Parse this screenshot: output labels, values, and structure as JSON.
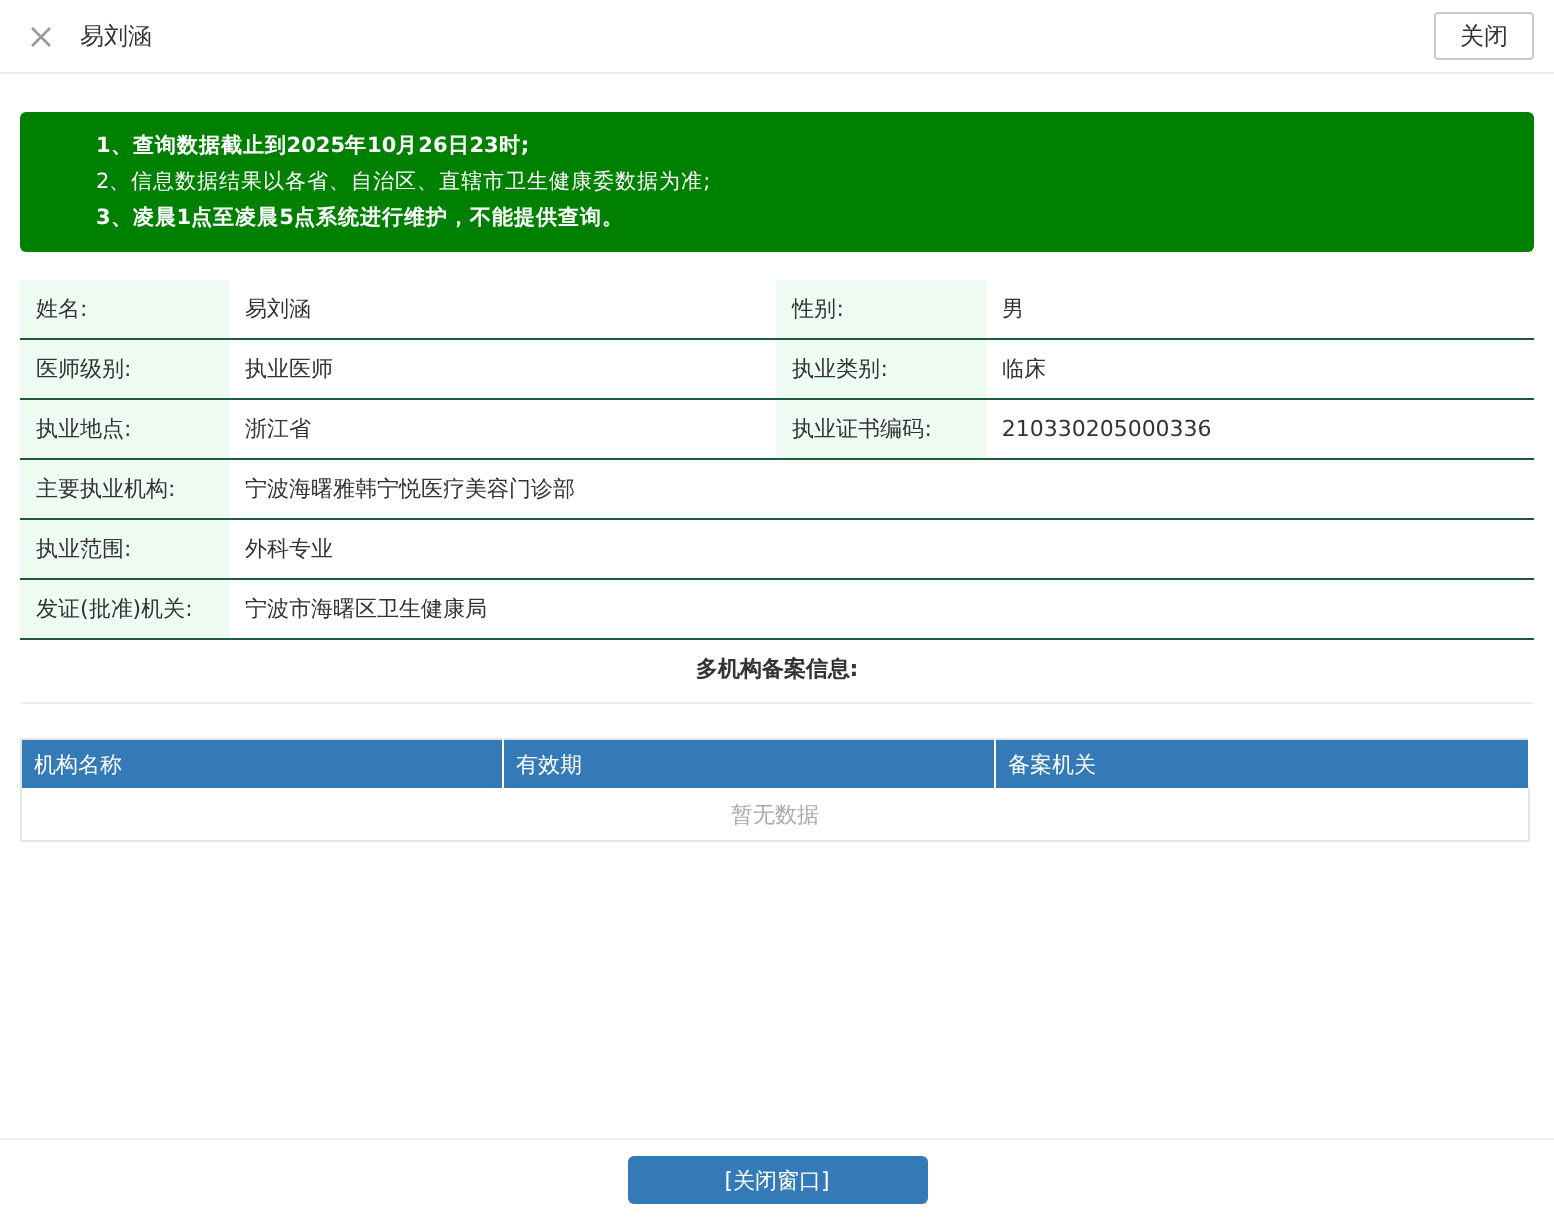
{
  "header": {
    "title": "易刘涵",
    "close_button": "关闭"
  },
  "notice": [
    {
      "text": "1、查询数据截止到2025年10月26日23时;",
      "bold": true
    },
    {
      "text": "2、信息数据结果以各省、自治区、直辖市卫生健康委数据为准;",
      "bold": false
    },
    {
      "text": "3、凌晨1点至凌晨5点系统进行维护，不能提供查询。",
      "bold": true
    }
  ],
  "info_rows": [
    {
      "cells": [
        {
          "label": "姓名:",
          "value": "易刘涵"
        },
        {
          "label": "性别:",
          "value": "男"
        }
      ]
    },
    {
      "cells": [
        {
          "label": "医师级别:",
          "value": "执业医师"
        },
        {
          "label": "执业类别:",
          "value": "临床"
        }
      ]
    },
    {
      "cells": [
        {
          "label": "执业地点:",
          "value": "浙江省"
        },
        {
          "label": "执业证书编码:",
          "value": "210330205000336"
        }
      ]
    },
    {
      "cells": [
        {
          "label": "主要执业机构:",
          "value": "宁波海曙雅韩宁悦医疗美容门诊部"
        }
      ]
    },
    {
      "cells": [
        {
          "label": "执业范围:",
          "value": "外科专业"
        }
      ]
    },
    {
      "cells": [
        {
          "label": "发证(批准)机关:",
          "value": "宁波市海曙区卫生健康局"
        }
      ]
    }
  ],
  "section_title": "多机构备案信息:",
  "table": {
    "columns": [
      "机构名称",
      "有效期",
      "备案机关"
    ],
    "empty_text": "暂无数据"
  },
  "footer_button": "[关闭窗口]"
}
